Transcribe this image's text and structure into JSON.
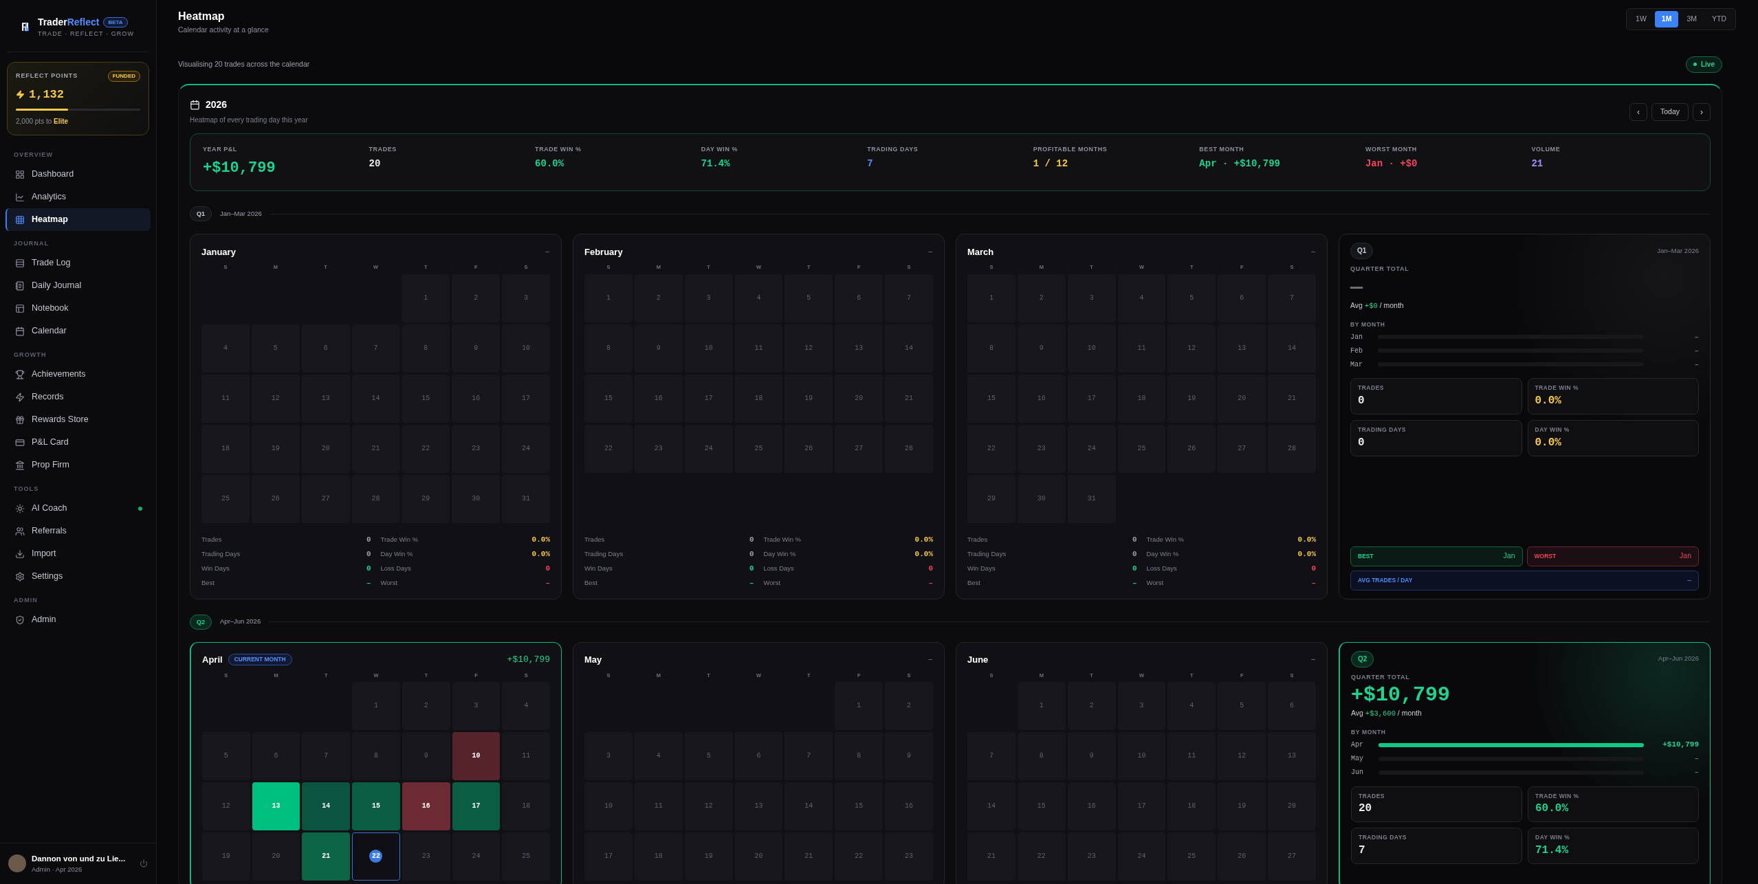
{
  "sidebar": {
    "brand": {
      "name_part1": "Trader",
      "name_part2": "Reflect",
      "badge": "BETA",
      "tagline": "TRADE · REFLECT · GROW"
    },
    "points": {
      "title": "REFLECT POINTS",
      "badge": "FUNDED",
      "value": "1,132",
      "level": 0.42,
      "note": "2,000 pts to ",
      "target": "Elite"
    },
    "sections": [
      {
        "title": "OVERVIEW",
        "items": [
          {
            "label": "Dashboard",
            "selected": false,
            "dot": false
          },
          {
            "label": "Analytics",
            "selected": false,
            "dot": false
          },
          {
            "label": "Heatmap",
            "selected": true,
            "dot": false
          }
        ]
      },
      {
        "title": "JOURNAL",
        "items": [
          {
            "label": "Trade Log",
            "selected": false,
            "dot": false
          },
          {
            "label": "Daily Journal",
            "selected": false,
            "dot": false
          },
          {
            "label": "Notebook",
            "selected": false,
            "dot": false
          },
          {
            "label": "Calendar",
            "selected": false,
            "dot": false
          }
        ]
      },
      {
        "title": "GROWTH",
        "items": [
          {
            "label": "Achievements",
            "selected": false,
            "dot": false
          },
          {
            "label": "Records",
            "selected": false,
            "dot": false
          },
          {
            "label": "Rewards Store",
            "selected": false,
            "dot": false
          },
          {
            "label": "P&L Card",
            "selected": false,
            "dot": false
          },
          {
            "label": "Prop Firm",
            "selected": false,
            "dot": false
          }
        ]
      },
      {
        "title": "TOOLS",
        "items": [
          {
            "label": "AI Coach",
            "selected": false,
            "dot": true
          },
          {
            "label": "Referrals",
            "selected": false,
            "dot": false
          },
          {
            "label": "Import",
            "selected": false,
            "dot": false
          },
          {
            "label": "Settings",
            "selected": false,
            "dot": false
          }
        ]
      },
      {
        "title": "ADMIN",
        "items": [
          {
            "label": "Admin",
            "selected": false,
            "dot": false
          }
        ]
      }
    ],
    "user": {
      "name": "Dannon von und zu Lie...",
      "meta": "Admin · Apr 2026"
    }
  },
  "header": {
    "title": "Heatmap",
    "subtitle": "Calendar activity at a glance",
    "ranges": [
      {
        "label": "1W",
        "selected": false
      },
      {
        "label": "1M",
        "selected": true
      },
      {
        "label": "3M",
        "selected": false
      },
      {
        "label": "YTD",
        "selected": false
      }
    ],
    "summary": "Visualising 20 trades across the calendar",
    "live": "Live"
  },
  "year": {
    "title": "2026",
    "subtitle": "Heatmap of every trading day this year",
    "prev": "‹",
    "today": "Today",
    "next": "›",
    "stats": [
      {
        "label": "YEAR P&L",
        "value": "+$10,799",
        "color": "#1ed28f"
      },
      {
        "label": "TRADES",
        "value": "20",
        "color": "#e8eaee"
      },
      {
        "label": "TRADE WIN %",
        "value": "60.0%",
        "color": "#1ed28f"
      },
      {
        "label": "DAY WIN %",
        "value": "71.4%",
        "color": "#1ed28f"
      },
      {
        "label": "TRADING DAYS",
        "value": "7",
        "color": "#4f8dff"
      },
      {
        "label": "PROFITABLE MONTHS",
        "value": "1 / 12",
        "color": "#f5c84c"
      },
      {
        "label": "BEST MONTH",
        "value": "Apr · +$10,799",
        "color": "#1ed28f"
      },
      {
        "label": "WORST MONTH",
        "value": "Jan · +$0",
        "color": "#f0455c"
      },
      {
        "label": "VOLUME",
        "value": "21",
        "color": "#a78bfa"
      }
    ]
  },
  "quarters": [
    {
      "label": "Q1",
      "range": "Jan–Mar 2026",
      "active": false,
      "months": [
        {
          "name": "January",
          "current": false,
          "total": "–",
          "weekdays": [
            "S",
            "M",
            "T",
            "W",
            "T",
            "F",
            "S"
          ],
          "weeks": [
            [
              {
                "kind": "blank"
              },
              {
                "kind": "blank"
              },
              {
                "kind": "blank"
              },
              {
                "kind": "blank"
              },
              {
                "kind": "day",
                "d": "1",
                "today": false
              },
              {
                "kind": "day",
                "d": "2",
                "today": false
              },
              {
                "kind": "day",
                "d": "3",
                "today": false
              }
            ],
            [
              {
                "kind": "day",
                "d": "4",
                "today": false
              },
              {
                "kind": "day",
                "d": "5",
                "today": false
              },
              {
                "kind": "day",
                "d": "6",
                "today": false
              },
              {
                "kind": "day",
                "d": "7",
                "today": false
              },
              {
                "kind": "day",
                "d": "8",
                "today": false
              },
              {
                "kind": "day",
                "d": "9",
                "today": false
              },
              {
                "kind": "day",
                "d": "10",
                "today": false
              }
            ],
            [
              {
                "kind": "day",
                "d": "11",
                "today": false
              },
              {
                "kind": "day",
                "d": "12",
                "today": false
              },
              {
                "kind": "day",
                "d": "13",
                "today": false
              },
              {
                "kind": "day",
                "d": "14",
                "today": false
              },
              {
                "kind": "day",
                "d": "15",
                "today": false
              },
              {
                "kind": "day",
                "d": "16",
                "today": false
              },
              {
                "kind": "day",
                "d": "17",
                "today": false
              }
            ],
            [
              {
                "kind": "day",
                "d": "18",
                "today": false
              },
              {
                "kind": "day",
                "d": "19",
                "today": false
              },
              {
                "kind": "day",
                "d": "20",
                "today": false
              },
              {
                "kind": "day",
                "d": "21",
                "today": false
              },
              {
                "kind": "day",
                "d": "22",
                "today": false
              },
              {
                "kind": "day",
                "d": "23",
                "today": false
              },
              {
                "kind": "day",
                "d": "24",
                "today": false
              }
            ],
            [
              {
                "kind": "day",
                "d": "25",
                "today": false
              },
              {
                "kind": "day",
                "d": "26",
                "today": false
              },
              {
                "kind": "day",
                "d": "27",
                "today": false
              },
              {
                "kind": "day",
                "d": "28",
                "today": false
              },
              {
                "kind": "day",
                "d": "29",
                "today": false
              },
              {
                "kind": "day",
                "d": "30",
                "today": false
              },
              {
                "kind": "day",
                "d": "31",
                "today": false
              }
            ]
          ],
          "stats": [
            {
              "label": "Trades",
              "value": "0",
              "color": "#9aa0ad"
            },
            {
              "label": "Trade Win %",
              "value": "0.0%",
              "color": "#f5c84c"
            },
            {
              "label": "Trading Days",
              "value": "0",
              "color": "#9aa0ad"
            },
            {
              "label": "Day Win %",
              "value": "0.0%",
              "color": "#f5c84c"
            },
            {
              "label": "Win Days",
              "value": "0",
              "color": "#1ed28f"
            },
            {
              "label": "Loss Days",
              "value": "0",
              "color": "#f0455c"
            },
            {
              "label": "Best",
              "value": "–",
              "color": "#1ed28f"
            },
            {
              "label": "Worst",
              "value": "–",
              "color": "#f0455c"
            }
          ]
        },
        {
          "name": "February",
          "current": false,
          "total": "–",
          "weekdays": [
            "S",
            "M",
            "T",
            "W",
            "T",
            "F",
            "S"
          ],
          "weeks": [
            [
              {
                "kind": "day",
                "d": "1",
                "today": false
              },
              {
                "kind": "day",
                "d": "2",
                "today": false
              },
              {
                "kind": "day",
                "d": "3",
                "today": false
              },
              {
                "kind": "day",
                "d": "4",
                "today": false
              },
              {
                "kind": "day",
                "d": "5",
                "today": false
              },
              {
                "kind": "day",
                "d": "6",
                "today": false
              },
              {
                "kind": "day",
                "d": "7",
                "today": false
              }
            ],
            [
              {
                "kind": "day",
                "d": "8",
                "today": false
              },
              {
                "kind": "day",
                "d": "9",
                "today": false
              },
              {
                "kind": "day",
                "d": "10",
                "today": false
              },
              {
                "kind": "day",
                "d": "11",
                "today": false
              },
              {
                "kind": "day",
                "d": "12",
                "today": false
              },
              {
                "kind": "day",
                "d": "13",
                "today": false
              },
              {
                "kind": "day",
                "d": "14",
                "today": false
              }
            ],
            [
              {
                "kind": "day",
                "d": "15",
                "today": false
              },
              {
                "kind": "day",
                "d": "16",
                "today": false
              },
              {
                "kind": "day",
                "d": "17",
                "today": false
              },
              {
                "kind": "day",
                "d": "18",
                "today": false
              },
              {
                "kind": "day",
                "d": "19",
                "today": false
              },
              {
                "kind": "day",
                "d": "20",
                "today": false
              },
              {
                "kind": "day",
                "d": "21",
                "today": false
              }
            ],
            [
              {
                "kind": "day",
                "d": "22",
                "today": false
              },
              {
                "kind": "day",
                "d": "23",
                "today": false
              },
              {
                "kind": "day",
                "d": "24",
                "today": false
              },
              {
                "kind": "day",
                "d": "25",
                "today": false
              },
              {
                "kind": "day",
                "d": "26",
                "today": false
              },
              {
                "kind": "day",
                "d": "27",
                "today": false
              },
              {
                "kind": "day",
                "d": "28",
                "today": false
              }
            ]
          ],
          "stats": [
            {
              "label": "Trades",
              "value": "0",
              "color": "#9aa0ad"
            },
            {
              "label": "Trade Win %",
              "value": "0.0%",
              "color": "#f5c84c"
            },
            {
              "label": "Trading Days",
              "value": "0",
              "color": "#9aa0ad"
            },
            {
              "label": "Day Win %",
              "value": "0.0%",
              "color": "#f5c84c"
            },
            {
              "label": "Win Days",
              "value": "0",
              "color": "#1ed28f"
            },
            {
              "label": "Loss Days",
              "value": "0",
              "color": "#f0455c"
            },
            {
              "label": "Best",
              "value": "–",
              "color": "#1ed28f"
            },
            {
              "label": "Worst",
              "value": "–",
              "color": "#f0455c"
            }
          ]
        },
        {
          "name": "March",
          "current": false,
          "total": "–",
          "weekdays": [
            "S",
            "M",
            "T",
            "W",
            "T",
            "F",
            "S"
          ],
          "weeks": [
            [
              {
                "kind": "day",
                "d": "1",
                "today": false
              },
              {
                "kind": "day",
                "d": "2",
                "today": false
              },
              {
                "kind": "day",
                "d": "3",
                "today": false
              },
              {
                "kind": "day",
                "d": "4",
                "today": false
              },
              {
                "kind": "day",
                "d": "5",
                "today": false
              },
              {
                "kind": "day",
                "d": "6",
                "today": false
              },
              {
                "kind": "day",
                "d": "7",
                "today": false
              }
            ],
            [
              {
                "kind": "day",
                "d": "8",
                "today": false
              },
              {
                "kind": "day",
                "d": "9",
                "today": false
              },
              {
                "kind": "day",
                "d": "10",
                "today": false
              },
              {
                "kind": "day",
                "d": "11",
                "today": false
              },
              {
                "kind": "day",
                "d": "12",
                "today": false
              },
              {
                "kind": "day",
                "d": "13",
                "today": false
              },
              {
                "kind": "day",
                "d": "14",
                "today": false
              }
            ],
            [
              {
                "kind": "day",
                "d": "15",
                "today": false
              },
              {
                "kind": "day",
                "d": "16",
                "today": false
              },
              {
                "kind": "day",
                "d": "17",
                "today": false
              },
              {
                "kind": "day",
                "d": "18",
                "today": false
              },
              {
                "kind": "day",
                "d": "19",
                "today": false
              },
              {
                "kind": "day",
                "d": "20",
                "today": false
              },
              {
                "kind": "day",
                "d": "21",
                "today": false
              }
            ],
            [
              {
                "kind": "day",
                "d": "22",
                "today": false
              },
              {
                "kind": "day",
                "d": "23",
                "today": false
              },
              {
                "kind": "day",
                "d": "24",
                "today": false
              },
              {
                "kind": "day",
                "d": "25",
                "today": false
              },
              {
                "kind": "day",
                "d": "26",
                "today": false
              },
              {
                "kind": "day",
                "d": "27",
                "today": false
              },
              {
                "kind": "day",
                "d": "28",
                "today": false
              }
            ],
            [
              {
                "kind": "day",
                "d": "29",
                "today": false
              },
              {
                "kind": "day",
                "d": "30",
                "today": false
              },
              {
                "kind": "day",
                "d": "31",
                "today": false
              }
            ]
          ],
          "stats": [
            {
              "label": "Trades",
              "value": "0",
              "color": "#9aa0ad"
            },
            {
              "label": "Trade Win %",
              "value": "0.0%",
              "color": "#f5c84c"
            },
            {
              "label": "Trading Days",
              "value": "0",
              "color": "#9aa0ad"
            },
            {
              "label": "Day Win %",
              "value": "0.0%",
              "color": "#f5c84c"
            },
            {
              "label": "Win Days",
              "value": "0",
              "color": "#1ed28f"
            },
            {
              "label": "Loss Days",
              "value": "0",
              "color": "#f0455c"
            },
            {
              "label": "Best",
              "value": "–",
              "color": "#1ed28f"
            },
            {
              "label": "Worst",
              "value": "–",
              "color": "#f0455c"
            }
          ]
        }
      ],
      "summary": {
        "badge": "Q1",
        "range": "Jan–Mar 2026",
        "title": "QUARTER TOTAL",
        "total": {
          "text": "—",
          "color": "#6b7080"
        },
        "avg_prefix": "Avg",
        "avg_value": "+$0",
        "avg_suffix": "/ month",
        "by_month_title": "BY MONTH",
        "by_month": [
          {
            "label": "Jan",
            "level": 0,
            "value": "–",
            "color": "#6b7080"
          },
          {
            "label": "Feb",
            "level": 0,
            "value": "–",
            "color": "#6b7080"
          },
          {
            "label": "Mar",
            "level": 0,
            "value": "–",
            "color": "#6b7080"
          }
        ],
        "tiles": [
          {
            "label": "TRADES",
            "value": "0",
            "color": "#e8eaee"
          },
          {
            "label": "TRADE WIN %",
            "value": "0.0%",
            "color": "#f5c84c"
          },
          {
            "label": "TRADING DAYS",
            "value": "0",
            "color": "#e8eaee"
          },
          {
            "label": "DAY WIN %",
            "value": "0.0%",
            "color": "#f5c84c"
          }
        ],
        "chips": [
          {
            "kind": "best",
            "label": "BEST",
            "value": "Jan"
          },
          {
            "kind": "worst",
            "label": "WORST",
            "value": "Jan"
          },
          {
            "kind": "avg",
            "label": "AVG TRADES / DAY",
            "value": "–"
          }
        ]
      }
    },
    {
      "label": "Q2",
      "range": "Apr–Jun 2026",
      "active": true,
      "months": [
        {
          "name": "April",
          "current": true,
          "badge": "CURRENT MONTH",
          "total": "+$10,799",
          "weekdays": [
            "S",
            "M",
            "T",
            "W",
            "T",
            "F",
            "S"
          ],
          "weeks": [
            [
              {
                "kind": "blank"
              },
              {
                "kind": "blank"
              },
              {
                "kind": "blank"
              },
              {
                "kind": "day",
                "d": "1",
                "today": false
              },
              {
                "kind": "day",
                "d": "2",
                "today": false
              },
              {
                "kind": "day",
                "d": "3",
                "today": false
              },
              {
                "kind": "day",
                "d": "4",
                "today": false
              }
            ],
            [
              {
                "kind": "day",
                "d": "5",
                "today": false
              },
              {
                "kind": "day",
                "d": "6",
                "today": false
              },
              {
                "kind": "day",
                "d": "7",
                "today": false
              },
              {
                "kind": "day",
                "d": "8",
                "today": false
              },
              {
                "kind": "day",
                "d": "9",
                "today": false
              },
              {
                "kind": "day",
                "d": "10",
                "today": false,
                "color": "#552329"
              },
              {
                "kind": "day",
                "d": "11",
                "today": false
              }
            ],
            [
              {
                "kind": "day",
                "d": "12",
                "today": false
              },
              {
                "kind": "day",
                "d": "13",
                "today": false,
                "color": "#00c07f"
              },
              {
                "kind": "day",
                "d": "14",
                "today": false,
                "color": "#0b5540"
              },
              {
                "kind": "day",
                "d": "15",
                "today": false,
                "color": "#0a5c43"
              },
              {
                "kind": "day",
                "d": "16",
                "today": false,
                "color": "#6d2b36"
              },
              {
                "kind": "day",
                "d": "17",
                "today": false,
                "color": "#0a5c43"
              },
              {
                "kind": "day",
                "d": "18",
                "today": false
              }
            ],
            [
              {
                "kind": "day",
                "d": "19",
                "today": false
              },
              {
                "kind": "day",
                "d": "20",
                "today": false
              },
              {
                "kind": "day",
                "d": "21",
                "today": false,
                "color": "#0b6446"
              },
              {
                "kind": "day",
                "d": "22",
                "today": true
              },
              {
                "kind": "day",
                "d": "23",
                "today": false
              },
              {
                "kind": "day",
                "d": "24",
                "today": false
              },
              {
                "kind": "day",
                "d": "25",
                "today": false
              }
            ]
          ]
        },
        {
          "name": "May",
          "current": false,
          "total": "–",
          "weekdays": [
            "S",
            "M",
            "T",
            "W",
            "T",
            "F",
            "S"
          ],
          "weeks": [
            [
              {
                "kind": "blank"
              },
              {
                "kind": "blank"
              },
              {
                "kind": "blank"
              },
              {
                "kind": "blank"
              },
              {
                "kind": "blank"
              },
              {
                "kind": "day",
                "d": "1",
                "today": false
              },
              {
                "kind": "day",
                "d": "2",
                "today": false
              }
            ],
            [
              {
                "kind": "day",
                "d": "3",
                "today": false
              },
              {
                "kind": "day",
                "d": "4",
                "today": false
              },
              {
                "kind": "day",
                "d": "5",
                "today": false
              },
              {
                "kind": "day",
                "d": "6",
                "today": false
              },
              {
                "kind": "day",
                "d": "7",
                "today": false
              },
              {
                "kind": "day",
                "d": "8",
                "today": false
              },
              {
                "kind": "day",
                "d": "9",
                "today": false
              }
            ],
            [
              {
                "kind": "day",
                "d": "10",
                "today": false
              },
              {
                "kind": "day",
                "d": "11",
                "today": false
              },
              {
                "kind": "day",
                "d": "12",
                "today": false
              },
              {
                "kind": "day",
                "d": "13",
                "today": false
              },
              {
                "kind": "day",
                "d": "14",
                "today": false
              },
              {
                "kind": "day",
                "d": "15",
                "today": false
              },
              {
                "kind": "day",
                "d": "16",
                "today": false
              }
            ],
            [
              {
                "kind": "day",
                "d": "17",
                "today": false
              },
              {
                "kind": "day",
                "d": "18",
                "today": false
              },
              {
                "kind": "day",
                "d": "19",
                "today": false
              },
              {
                "kind": "day",
                "d": "20",
                "today": false
              },
              {
                "kind": "day",
                "d": "21",
                "today": false
              },
              {
                "kind": "day",
                "d": "22",
                "today": false
              },
              {
                "kind": "day",
                "d": "23",
                "today": false
              }
            ]
          ]
        },
        {
          "name": "June",
          "current": false,
          "total": "–",
          "weekdays": [
            "S",
            "M",
            "T",
            "W",
            "T",
            "F",
            "S"
          ],
          "weeks": [
            [
              {
                "kind": "blank"
              },
              {
                "kind": "day",
                "d": "1",
                "today": false
              },
              {
                "kind": "day",
                "d": "2",
                "today": false
              },
              {
                "kind": "day",
                "d": "3",
                "today": false
              },
              {
                "kind": "day",
                "d": "4",
                "today": false
              },
              {
                "kind": "day",
                "d": "5",
                "today": false
              },
              {
                "kind": "day",
                "d": "6",
                "today": false
              }
            ],
            [
              {
                "kind": "day",
                "d": "7",
                "today": false
              },
              {
                "kind": "day",
                "d": "8",
                "today": false
              },
              {
                "kind": "day",
                "d": "9",
                "today": false
              },
              {
                "kind": "day",
                "d": "10",
                "today": false
              },
              {
                "kind": "day",
                "d": "11",
                "today": false
              },
              {
                "kind": "day",
                "d": "12",
                "today": false
              },
              {
                "kind": "day",
                "d": "13",
                "today": false
              }
            ],
            [
              {
                "kind": "day",
                "d": "14",
                "today": false
              },
              {
                "kind": "day",
                "d": "15",
                "today": false
              },
              {
                "kind": "day",
                "d": "16",
                "today": false
              },
              {
                "kind": "day",
                "d": "17",
                "today": false
              },
              {
                "kind": "day",
                "d": "18",
                "today": false
              },
              {
                "kind": "day",
                "d": "19",
                "today": false
              },
              {
                "kind": "day",
                "d": "20",
                "today": false
              }
            ],
            [
              {
                "kind": "day",
                "d": "21",
                "today": false
              },
              {
                "kind": "day",
                "d": "22",
                "today": false
              },
              {
                "kind": "day",
                "d": "23",
                "today": false
              },
              {
                "kind": "day",
                "d": "24",
                "today": false
              },
              {
                "kind": "day",
                "d": "25",
                "today": false
              },
              {
                "kind": "day",
                "d": "26",
                "today": false
              },
              {
                "kind": "day",
                "d": "27",
                "today": false
              }
            ]
          ]
        }
      ],
      "summary": {
        "badge": "Q2",
        "range": "Apr–Jun 2026",
        "title": "QUARTER TOTAL",
        "total": {
          "text": "+$10,799",
          "color": "#1ed28f"
        },
        "avg_prefix": "Avg",
        "avg_value": "+$3,600",
        "avg_suffix": "/ month",
        "by_month_title": "BY MONTH",
        "by_month": [
          {
            "label": "Apr",
            "level": 1,
            "value": "+$10,799",
            "color": "#1ed28f"
          },
          {
            "label": "May",
            "level": 0,
            "value": "–",
            "color": "#6b7080"
          },
          {
            "label": "Jun",
            "level": 0,
            "value": "–",
            "color": "#6b7080"
          }
        ],
        "tiles": [
          {
            "label": "TRADES",
            "value": "20",
            "color": "#e8eaee"
          },
          {
            "label": "TRADE WIN %",
            "value": "60.0%",
            "color": "#1ed28f"
          },
          {
            "label": "TRADING DAYS",
            "value": "7",
            "color": "#e8eaee"
          },
          {
            "label": "DAY WIN %",
            "value": "71.4%",
            "color": "#1ed28f"
          }
        ]
      }
    }
  ]
}
